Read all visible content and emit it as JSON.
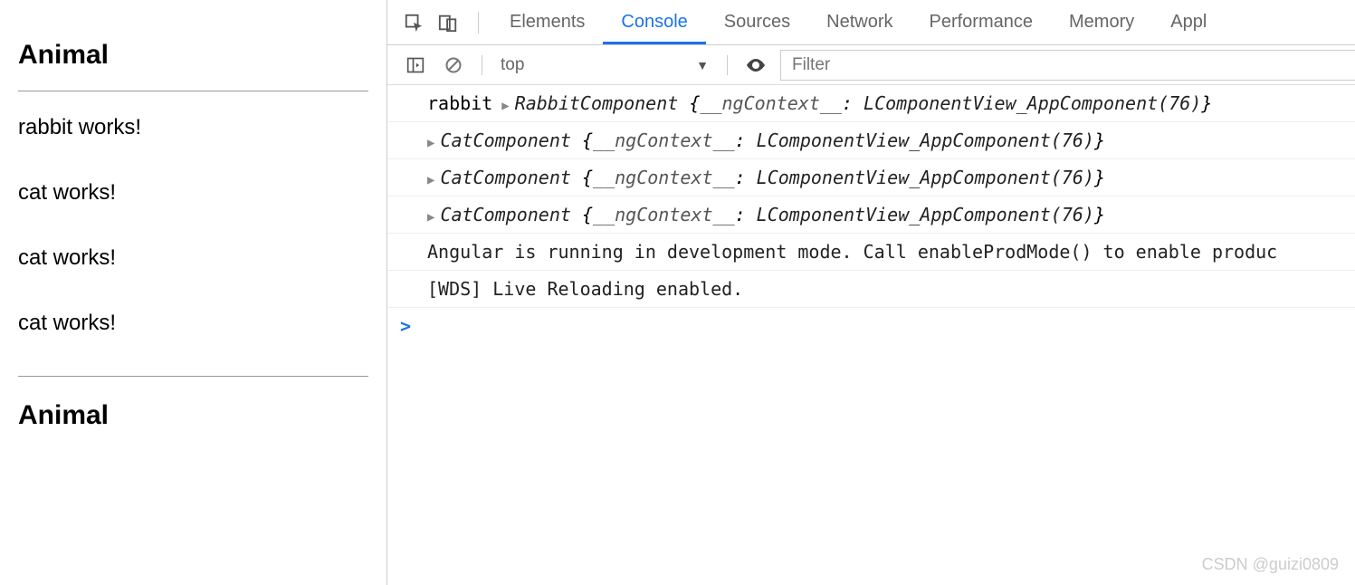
{
  "page": {
    "heading1": "Animal",
    "heading2": "Animal",
    "items": [
      "rabbit works!",
      "cat works!",
      "cat works!",
      "cat works!"
    ]
  },
  "devtools": {
    "tabs": [
      "Elements",
      "Console",
      "Sources",
      "Network",
      "Performance",
      "Memory",
      "Appl"
    ],
    "active_tab": "Console",
    "context": "top",
    "filter_placeholder": "Filter"
  },
  "console": {
    "rows": [
      {
        "prefix": "rabbit",
        "name": "RabbitComponent",
        "key": "__ngContext__",
        "val": "LComponentView_AppComponent(76)"
      },
      {
        "prefix": "",
        "name": "CatComponent",
        "key": "__ngContext__",
        "val": "LComponentView_AppComponent(76)"
      },
      {
        "prefix": "",
        "name": "CatComponent",
        "key": "__ngContext__",
        "val": "LComponentView_AppComponent(76)"
      },
      {
        "prefix": "",
        "name": "CatComponent",
        "key": "__ngContext__",
        "val": "LComponentView_AppComponent(76)"
      }
    ],
    "messages": [
      "Angular is running in development mode. Call enableProdMode() to enable produc",
      "[WDS] Live Reloading enabled."
    ],
    "prompt": ">"
  },
  "watermark": "CSDN @guizi0809"
}
